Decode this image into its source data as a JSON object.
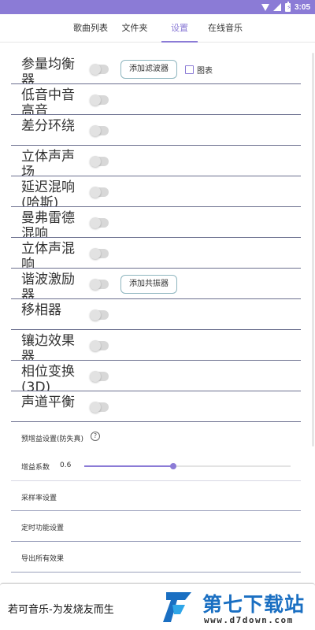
{
  "status_bar": {
    "time": "3:05",
    "icons": [
      "wifi-icon",
      "signal-icon",
      "battery-charging-icon"
    ],
    "color": "#8b7bd6"
  },
  "tabs": [
    {
      "label": "歌曲列表",
      "active": false
    },
    {
      "label": "文件夹",
      "active": false
    },
    {
      "label": "设置",
      "active": true
    },
    {
      "label": "在线音乐",
      "active": false
    }
  ],
  "effects": [
    {
      "name": "参量均衡器",
      "enabled": false,
      "button": "添加滤波器",
      "checkbox": "图表"
    },
    {
      "name": "低音中音高音",
      "enabled": false
    },
    {
      "name": "差分环绕",
      "enabled": false
    },
    {
      "name": "立体声声场",
      "enabled": false
    },
    {
      "name": "延迟混响(哈斯)",
      "enabled": false
    },
    {
      "name": "曼弗雷德混响",
      "enabled": false
    },
    {
      "name": "立体声混响",
      "enabled": false
    },
    {
      "name": "谐波激励器",
      "enabled": false,
      "button": "添加共振器"
    },
    {
      "name": "移相器",
      "enabled": false
    },
    {
      "name": "镶边效果器",
      "enabled": false
    },
    {
      "name": "相位变换(3D)",
      "enabled": false
    },
    {
      "name": "声道平衡",
      "enabled": false
    }
  ],
  "settings": {
    "preamp_label": "预增益设置(防失真)",
    "gain_label": "增益系数",
    "gain_value": "0.6",
    "gain_fraction": 0.43,
    "sample_rate_label": "采样率设置",
    "timer_label": "定时功能设置",
    "export_label": "导出所有效果"
  },
  "player": {
    "title": "若可音乐-为发烧友而生"
  },
  "watermark": {
    "text": "第七下载站",
    "url": "www.d7down.com"
  },
  "accent_color": "#8b7bd6"
}
